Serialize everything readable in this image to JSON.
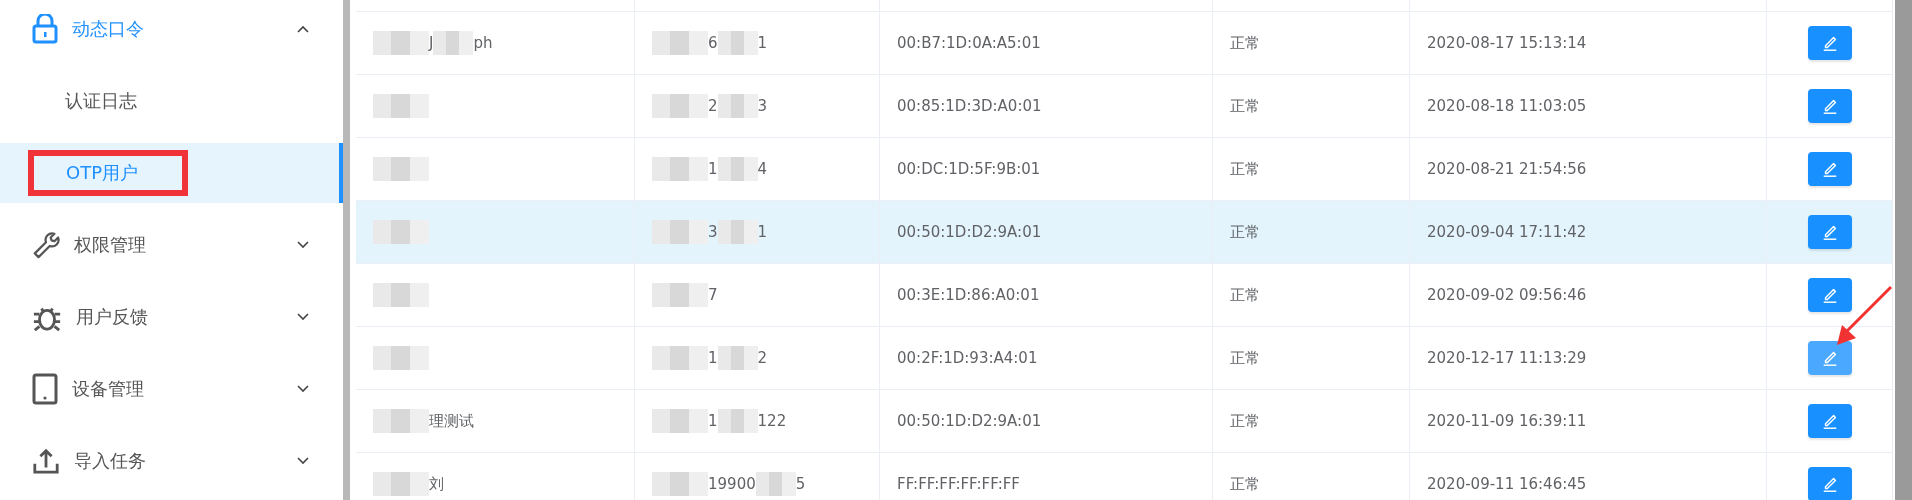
{
  "sidebar": {
    "items": [
      {
        "label": "动态口令",
        "expanded": true,
        "children": [
          {
            "label": "认证日志",
            "selected": false,
            "annotated": false
          },
          {
            "label": "OTP用户",
            "selected": true,
            "annotated": true
          }
        ]
      },
      {
        "label": "权限管理",
        "expanded": false
      },
      {
        "label": "用户反馈",
        "expanded": false
      },
      {
        "label": "设备管理",
        "expanded": false
      },
      {
        "label": "导入任务",
        "expanded": false
      }
    ]
  },
  "table": {
    "rows": [
      {
        "selected": false,
        "name": [
          "J",
          "ph"
        ],
        "phone": [
          "6",
          "1"
        ],
        "mac": "00:B7:1D:0A:A5:01",
        "status": "正常",
        "time": "2020-08-17 15:13:14",
        "edit": {
          "hovered": false,
          "arrow": false
        }
      },
      {
        "selected": false,
        "phone": [
          "2",
          "3"
        ],
        "mac": "00:85:1D:3D:A0:01",
        "status": "正常",
        "time": "2020-08-18 11:03:05",
        "edit": {
          "hovered": false,
          "arrow": false
        }
      },
      {
        "selected": false,
        "phone": [
          "1",
          "4"
        ],
        "mac": "00:DC:1D:5F:9B:01",
        "status": "正常",
        "time": "2020-08-21 21:54:56",
        "edit": {
          "hovered": false,
          "arrow": false
        }
      },
      {
        "selected": true,
        "phone": [
          "3",
          "1"
        ],
        "mac": "00:50:1D:D2:9A:01",
        "status": "正常",
        "time": "2020-09-04 17:11:42",
        "edit": {
          "hovered": false,
          "arrow": false
        }
      },
      {
        "selected": false,
        "phone": [
          "7"
        ],
        "mac": "00:3E:1D:86:A0:01",
        "status": "正常",
        "time": "2020-09-02 09:56:46",
        "edit": {
          "hovered": false,
          "arrow": false
        }
      },
      {
        "selected": false,
        "phone": [
          "1",
          "2"
        ],
        "mac": "00:2F:1D:93:A4:01",
        "status": "正常",
        "time": "2020-12-17 11:13:29",
        "edit": {
          "hovered": true,
          "arrow": true
        }
      },
      {
        "selected": false,
        "name": [
          "理测试"
        ],
        "phone": [
          "1",
          "122"
        ],
        "mac": "00:50:1D:D2:9A:01",
        "status": "正常",
        "time": "2020-11-09 16:39:11",
        "edit": {
          "hovered": false,
          "arrow": false
        }
      },
      {
        "selected": false,
        "name": [
          "刘"
        ],
        "phone": [
          "19900",
          "5"
        ],
        "mac": "FF:FF:FF:FF:FF:FF",
        "status": "正常",
        "time": "2020-09-11 16:46:45",
        "edit": {
          "hovered": false,
          "arrow": false
        }
      }
    ]
  }
}
